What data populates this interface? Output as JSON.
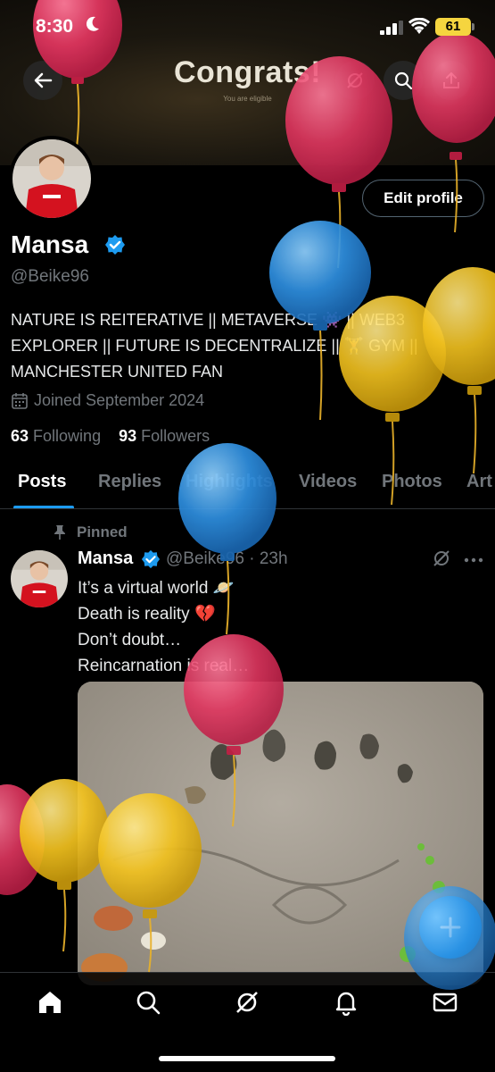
{
  "status_bar": {
    "time": "8:30",
    "battery": "61"
  },
  "banner": {
    "title": "Congrats!",
    "subtitle": "You are eligible"
  },
  "profile": {
    "edit_label": "Edit profile",
    "name": "Mansa",
    "handle": "@Beike96",
    "bio": "NATURE IS REITERATIVE || METAVERSE 👾 || WEB3 EXPLORER || FUTURE IS DECENTRALIZE || 🏋 GYM || MANCHESTER UNITED FAN",
    "joined": "Joined September 2024",
    "following_count": "63",
    "following_label": "Following",
    "followers_count": "93",
    "followers_label": "Followers"
  },
  "tabs": [
    {
      "label": "Posts",
      "active": true
    },
    {
      "label": "Replies"
    },
    {
      "label": "Highlights"
    },
    {
      "label": "Videos"
    },
    {
      "label": "Photos"
    },
    {
      "label": "Art"
    }
  ],
  "post": {
    "pinned_label": "Pinned",
    "name": "Mansa",
    "handle_time": "@Beike96 · 23h",
    "lines": [
      "It’s a virtual world 🪐",
      "Death is reality 💔",
      "Don’t doubt…",
      "Reincarnation is real…"
    ]
  },
  "colors": {
    "accent": "#1d9bf0",
    "balloon_red": "#e0365f",
    "balloon_blue": "#2e8fe0",
    "balloon_yellow": "#f2c21f"
  },
  "icons": [
    "back-arrow-icon",
    "grok-icon",
    "search-icon",
    "share-icon",
    "verified-icon",
    "calendar-icon",
    "pin-icon",
    "more-icon",
    "compose-plus-icon",
    "home-icon",
    "notifications-icon",
    "messages-icon"
  ]
}
